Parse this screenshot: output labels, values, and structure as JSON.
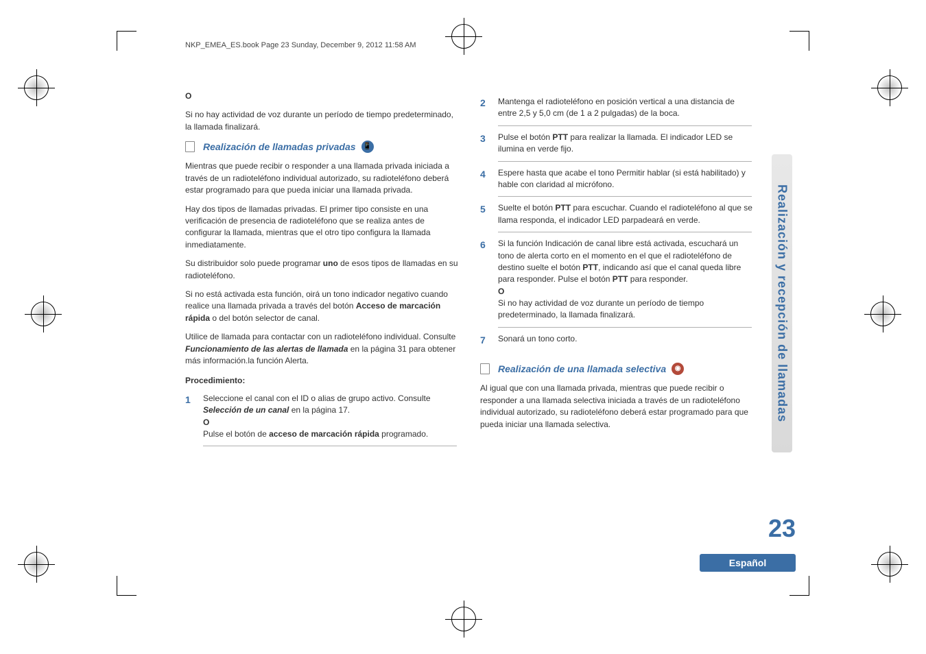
{
  "header": "NKP_EMEA_ES.book  Page 23  Sunday, December 9, 2012  11:58 AM",
  "leftCol": {
    "o1": "O",
    "noActivity": "Si no hay actividad de voz durante un período de tiempo predeterminado, la llamada finalizará.",
    "section1": "Realización de llamadas privadas",
    "p1": "Mientras que puede recibir o responder a una llamada privada iniciada a través de un radioteléfono individual autorizado, su radioteléfono deberá estar programado para que pueda iniciar una llamada privada.",
    "p2": "Hay dos tipos de llamadas privadas. El primer tipo consiste en una verificación de presencia de radioteléfono que se realiza antes de configurar la llamada, mientras que el otro tipo configura la llamada inmediatamente.",
    "p3a": "Su distribuidor solo puede programar ",
    "uno": "uno",
    "p3b": " de esos tipos de llamadas en su radioteléfono.",
    "p4a": "Si no está activada esta función, oirá un tono indicador negativo cuando realice una llamada privada a través del botón ",
    "acceso": "Acceso de marcación rápida",
    "p4b": " o del botón selector de canal.",
    "p5a": "Utilice  de llamada para contactar con un radioteléfono individual. Consulte ",
    "func": "Funcionamiento de las alertas de llamada",
    "p5b": " en la página 31 para obtener más información.la función Alerta.",
    "proc": "Procedimiento:",
    "s1n": "1",
    "s1a": "Seleccione el canal con el ID o alias de grupo activo. Consulte ",
    "sel": "Selección de un canal",
    "s1b": " en la página 17.",
    "o2": "O",
    "s1c": "Pulse el botón de ",
    "acc2": "acceso de marcación rápida",
    "s1d": " programado."
  },
  "rightCol": {
    "s2n": "2",
    "s2": "Mantenga el radioteléfono en posición vertical a una distancia de entre 2,5 y 5,0 cm (de 1 a 2 pulgadas) de la boca.",
    "s3n": "3",
    "s3a": "Pulse el botón ",
    "ptt": "PTT",
    "s3b": " para realizar la llamada. El indicador LED se ilumina en verde fijo.",
    "s4n": "4",
    "s4": "Espere hasta que acabe el tono Permitir hablar (si está habilitado) y hable con claridad al micrófono.",
    "s5n": "5",
    "s5a": "Suelte el botón ",
    "s5b": " para escuchar. Cuando el radioteléfono al que se llama responda, el indicador LED parpadeará en verde.",
    "s6n": "6",
    "s6a": "Si la función Indicación de canal libre está activada, escuchará un tono de alerta corto en el momento en el que el radioteléfono de destino suelte el botón ",
    "s6b": ", indicando así que el canal queda libre para responder. Pulse el botón ",
    "s6c": " para responder.",
    "o3": "O",
    "s6d": "Si no hay actividad de voz durante un período de tiempo predeterminado, la llamada finalizará.",
    "s7n": "7",
    "s7": "Sonará un tono corto.",
    "section2": "Realización de una llamada selectiva",
    "p6": "Al igual que con una llamada privada, mientras que puede recibir o responder a una llamada selectiva iniciada a través de un radioteléfono individual autorizado, su radioteléfono deberá estar programado para que pueda iniciar una llamada selectiva."
  },
  "sidebarText": "Realización y recepción de llamadas",
  "pageNumber": "23",
  "language": "Español",
  "iconPrivate": "📱",
  "iconSelective": "◉"
}
